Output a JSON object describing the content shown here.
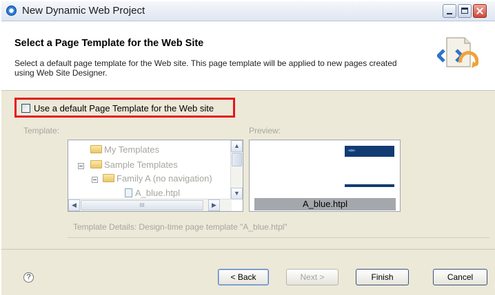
{
  "window": {
    "title": "New Dynamic Web Project"
  },
  "banner": {
    "title": "Select a Page Template for the Web Site",
    "description": "Select a default page template for the Web site. This page template will be applied to new pages created using Web Site Designer."
  },
  "options": {
    "use_default_template_label": "Use a default Page Template for the Web site",
    "use_default_template_checked": false
  },
  "template": {
    "label": "Template:",
    "tree": [
      {
        "label": "My Templates",
        "icon": "folder-icon"
      },
      {
        "label": "Sample Templates",
        "icon": "folder-icon"
      },
      {
        "label": "Family A (no navigation)",
        "icon": "folder-icon"
      },
      {
        "label": "A_blue.htpl",
        "icon": "template-file-icon"
      }
    ],
    "hscroll_grip": "III"
  },
  "preview": {
    "label": "Preview:",
    "caption": "A_blue.htpl"
  },
  "details": {
    "text": "Template Details:  Design-time page template \"A_blue.htpl\""
  },
  "footer": {
    "help_glyph": "?",
    "back": "< Back",
    "next": "Next >",
    "finish": "Finish",
    "cancel": "Cancel"
  },
  "colors": {
    "highlight_border": "#e8131b",
    "disabled_text": "#a7a6a0",
    "preview_band": "#123b73"
  }
}
